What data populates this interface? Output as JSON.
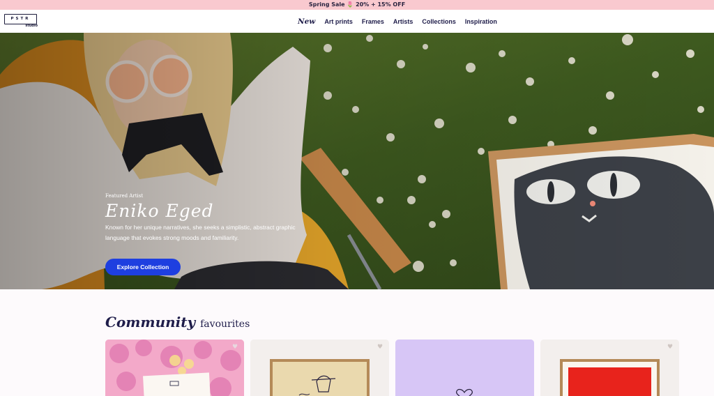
{
  "promo": {
    "text": "Spring Sale 🌷 20% + 15% OFF"
  },
  "logo": {
    "mark": "PSTR",
    "sub": "studio"
  },
  "nav": {
    "items": [
      "New",
      "Art prints",
      "Frames",
      "Artists",
      "Collections",
      "Inspiration"
    ]
  },
  "hero": {
    "eyebrow": "Featured Artist",
    "artist": "Eniko Eged",
    "description": "Known for her unique narratives, she seeks a simplistic, abstract graphic language that evokes strong moods and familiarity.",
    "cta": "Explore Collection"
  },
  "section": {
    "script": "Community",
    "plain": "favourites"
  },
  "cards": [
    {
      "bg": "#f0a6c8",
      "favorite": false
    },
    {
      "bg": "#f3efed",
      "favorite": false
    },
    {
      "bg": "#d6c5f5",
      "favorite": false
    },
    {
      "bg": "#f3efed",
      "favorite": false
    }
  ],
  "colors": {
    "accent": "#1e3fe0",
    "promo": "#f9c9cf",
    "ink": "#1f1d4a"
  }
}
